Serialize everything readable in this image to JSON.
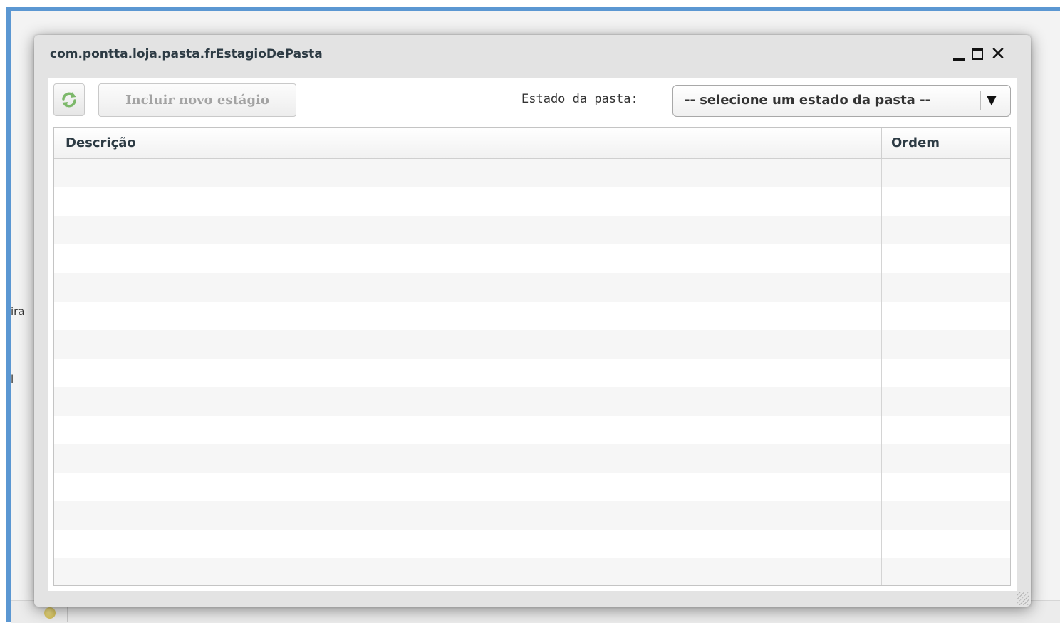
{
  "background": {
    "side_labels": [
      "ira",
      "l"
    ],
    "accent_color": "#5b97d2"
  },
  "window": {
    "title": "com.pontta.loja.pasta.frEstagioDePasta",
    "controls": {
      "minimize": "minimize-icon",
      "maximize": "maximize-icon",
      "close": "close-icon"
    }
  },
  "toolbar": {
    "refresh_icon": "refresh-icon",
    "include_button_label": "Incluir novo estágio",
    "state_label": "Estado da pasta:",
    "state_select_value": "-- selecione um estado da pasta --"
  },
  "grid": {
    "columns": [
      "Descrição",
      "Ordem",
      ""
    ],
    "rows": []
  }
}
